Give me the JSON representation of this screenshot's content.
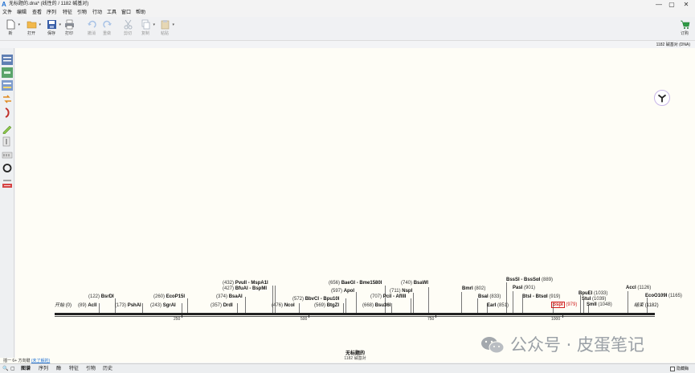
{
  "window": {
    "title": "无标题的.dna* (线性的 / 1182 碱基对)",
    "controls": [
      "—",
      "▢",
      "✕"
    ]
  },
  "menu": [
    "文件",
    "编辑",
    "查看",
    "序列",
    "特征",
    "引物",
    "行动",
    "工具",
    "窗口",
    "帮助"
  ],
  "toolbar": {
    "new_label": "新",
    "open_label": "打开",
    "save_label": "保存",
    "print_label": "打印",
    "undo_label": "撤消",
    "redo_label": "重做",
    "cut_label": "剪切",
    "copy_label": "复制",
    "paste_label": "粘贴",
    "order_label": "订购"
  },
  "seq_info": "1182 碱基对 (DNA)",
  "map": {
    "start_label": "开始",
    "start_pos": "(0)",
    "end_label": "结束",
    "end_pos": "(1182)",
    "ticks": [
      "250",
      "500",
      "750",
      "1000"
    ],
    "title": "无标题的",
    "subtitle": "1182 碱基对",
    "features": [
      {
        "pre": "(89)",
        "name": "AclI",
        "post": ""
      },
      {
        "pre": "(122)",
        "name": "BsrDI",
        "post": ""
      },
      {
        "pre": "(173)",
        "name": "PshAI",
        "post": ""
      },
      {
        "pre": "(243)",
        "name": "SgrAI",
        "post": ""
      },
      {
        "pre": "(260)",
        "name": "EcoP15I",
        "post": ""
      },
      {
        "pre": "(357)",
        "name": "DrdI",
        "post": ""
      },
      {
        "pre": "(374)",
        "name": "BsaAI",
        "post": ""
      },
      {
        "pre": "(427)",
        "name": "BfuAI - BspMI",
        "post": ""
      },
      {
        "pre": "(432)",
        "name": "PvuII - MspA1I",
        "post": ""
      },
      {
        "pre": "(476)",
        "name": "NcoI",
        "post": ""
      },
      {
        "pre": "(569)",
        "name": "BtgZI",
        "post": ""
      },
      {
        "pre": "(572)",
        "name": "BbvCI - Bpu10I",
        "post": ""
      },
      {
        "pre": "(597)",
        "name": "ApoI",
        "post": ""
      },
      {
        "pre": "(656)",
        "name": "BaeGI - Bme1580I",
        "post": ""
      },
      {
        "pre": "(668)",
        "name": "Bsu36I",
        "post": ""
      },
      {
        "pre": "(707)",
        "name": "PciI - AflIII",
        "post": ""
      },
      {
        "pre": "(711)",
        "name": "NspI",
        "post": ""
      },
      {
        "pre": "(740)",
        "name": "BsaWI",
        "post": ""
      },
      {
        "pre": "",
        "name": "BmrI",
        "post": "(802)"
      },
      {
        "pre": "",
        "name": "BsaI",
        "post": "(833)"
      },
      {
        "pre": "",
        "name": "EarI",
        "post": "(851)"
      },
      {
        "pre": "",
        "name": "BssSI - BssSαI",
        "post": "(889)"
      },
      {
        "pre": "",
        "name": "PasI",
        "post": "(901)"
      },
      {
        "pre": "",
        "name": "BtsI - BtsαI",
        "post": "(919)"
      },
      {
        "pre": "",
        "name": "SspI",
        "post": "(979)"
      },
      {
        "pre": "",
        "name": "BpuEI",
        "post": "(1033)"
      },
      {
        "pre": "",
        "name": "StuI",
        "post": "(1039)"
      },
      {
        "pre": "",
        "name": "SmlI",
        "post": "(1048)"
      },
      {
        "pre": "",
        "name": "AccI",
        "post": "(1126)"
      },
      {
        "pre": "",
        "name": "EcoO109I",
        "post": "(1165)"
      }
    ]
  },
  "pagestrip": {
    "text": "插一 6+ 方向键",
    "link": "(未了解的)"
  },
  "bottom_tabs": [
    "图谱",
    "序列",
    "酶",
    "特征",
    "引物",
    "历史"
  ],
  "hide_enzymes_label": "隐藏酶",
  "watermark": "公众号 · 皮蛋笔记",
  "colors": {
    "highlight": "#d02020",
    "accent": "#1e6fd2",
    "canvas_bg": "#fefdf6"
  }
}
